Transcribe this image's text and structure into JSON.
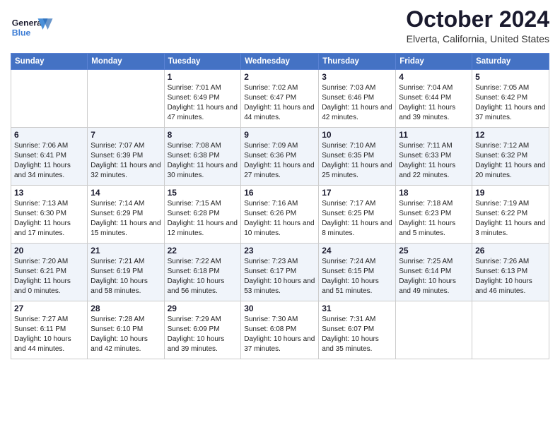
{
  "header": {
    "logo_line1": "General",
    "logo_line2": "Blue",
    "month_title": "October 2024",
    "location": "Elverta, California, United States"
  },
  "days_of_week": [
    "Sunday",
    "Monday",
    "Tuesday",
    "Wednesday",
    "Thursday",
    "Friday",
    "Saturday"
  ],
  "weeks": [
    [
      {
        "day": "",
        "sunrise": "",
        "sunset": "",
        "daylight": ""
      },
      {
        "day": "",
        "sunrise": "",
        "sunset": "",
        "daylight": ""
      },
      {
        "day": "1",
        "sunrise": "Sunrise: 7:01 AM",
        "sunset": "Sunset: 6:49 PM",
        "daylight": "Daylight: 11 hours and 47 minutes."
      },
      {
        "day": "2",
        "sunrise": "Sunrise: 7:02 AM",
        "sunset": "Sunset: 6:47 PM",
        "daylight": "Daylight: 11 hours and 44 minutes."
      },
      {
        "day": "3",
        "sunrise": "Sunrise: 7:03 AM",
        "sunset": "Sunset: 6:46 PM",
        "daylight": "Daylight: 11 hours and 42 minutes."
      },
      {
        "day": "4",
        "sunrise": "Sunrise: 7:04 AM",
        "sunset": "Sunset: 6:44 PM",
        "daylight": "Daylight: 11 hours and 39 minutes."
      },
      {
        "day": "5",
        "sunrise": "Sunrise: 7:05 AM",
        "sunset": "Sunset: 6:42 PM",
        "daylight": "Daylight: 11 hours and 37 minutes."
      }
    ],
    [
      {
        "day": "6",
        "sunrise": "Sunrise: 7:06 AM",
        "sunset": "Sunset: 6:41 PM",
        "daylight": "Daylight: 11 hours and 34 minutes."
      },
      {
        "day": "7",
        "sunrise": "Sunrise: 7:07 AM",
        "sunset": "Sunset: 6:39 PM",
        "daylight": "Daylight: 11 hours and 32 minutes."
      },
      {
        "day": "8",
        "sunrise": "Sunrise: 7:08 AM",
        "sunset": "Sunset: 6:38 PM",
        "daylight": "Daylight: 11 hours and 30 minutes."
      },
      {
        "day": "9",
        "sunrise": "Sunrise: 7:09 AM",
        "sunset": "Sunset: 6:36 PM",
        "daylight": "Daylight: 11 hours and 27 minutes."
      },
      {
        "day": "10",
        "sunrise": "Sunrise: 7:10 AM",
        "sunset": "Sunset: 6:35 PM",
        "daylight": "Daylight: 11 hours and 25 minutes."
      },
      {
        "day": "11",
        "sunrise": "Sunrise: 7:11 AM",
        "sunset": "Sunset: 6:33 PM",
        "daylight": "Daylight: 11 hours and 22 minutes."
      },
      {
        "day": "12",
        "sunrise": "Sunrise: 7:12 AM",
        "sunset": "Sunset: 6:32 PM",
        "daylight": "Daylight: 11 hours and 20 minutes."
      }
    ],
    [
      {
        "day": "13",
        "sunrise": "Sunrise: 7:13 AM",
        "sunset": "Sunset: 6:30 PM",
        "daylight": "Daylight: 11 hours and 17 minutes."
      },
      {
        "day": "14",
        "sunrise": "Sunrise: 7:14 AM",
        "sunset": "Sunset: 6:29 PM",
        "daylight": "Daylight: 11 hours and 15 minutes."
      },
      {
        "day": "15",
        "sunrise": "Sunrise: 7:15 AM",
        "sunset": "Sunset: 6:28 PM",
        "daylight": "Daylight: 11 hours and 12 minutes."
      },
      {
        "day": "16",
        "sunrise": "Sunrise: 7:16 AM",
        "sunset": "Sunset: 6:26 PM",
        "daylight": "Daylight: 11 hours and 10 minutes."
      },
      {
        "day": "17",
        "sunrise": "Sunrise: 7:17 AM",
        "sunset": "Sunset: 6:25 PM",
        "daylight": "Daylight: 11 hours and 8 minutes."
      },
      {
        "day": "18",
        "sunrise": "Sunrise: 7:18 AM",
        "sunset": "Sunset: 6:23 PM",
        "daylight": "Daylight: 11 hours and 5 minutes."
      },
      {
        "day": "19",
        "sunrise": "Sunrise: 7:19 AM",
        "sunset": "Sunset: 6:22 PM",
        "daylight": "Daylight: 11 hours and 3 minutes."
      }
    ],
    [
      {
        "day": "20",
        "sunrise": "Sunrise: 7:20 AM",
        "sunset": "Sunset: 6:21 PM",
        "daylight": "Daylight: 11 hours and 0 minutes."
      },
      {
        "day": "21",
        "sunrise": "Sunrise: 7:21 AM",
        "sunset": "Sunset: 6:19 PM",
        "daylight": "Daylight: 10 hours and 58 minutes."
      },
      {
        "day": "22",
        "sunrise": "Sunrise: 7:22 AM",
        "sunset": "Sunset: 6:18 PM",
        "daylight": "Daylight: 10 hours and 56 minutes."
      },
      {
        "day": "23",
        "sunrise": "Sunrise: 7:23 AM",
        "sunset": "Sunset: 6:17 PM",
        "daylight": "Daylight: 10 hours and 53 minutes."
      },
      {
        "day": "24",
        "sunrise": "Sunrise: 7:24 AM",
        "sunset": "Sunset: 6:15 PM",
        "daylight": "Daylight: 10 hours and 51 minutes."
      },
      {
        "day": "25",
        "sunrise": "Sunrise: 7:25 AM",
        "sunset": "Sunset: 6:14 PM",
        "daylight": "Daylight: 10 hours and 49 minutes."
      },
      {
        "day": "26",
        "sunrise": "Sunrise: 7:26 AM",
        "sunset": "Sunset: 6:13 PM",
        "daylight": "Daylight: 10 hours and 46 minutes."
      }
    ],
    [
      {
        "day": "27",
        "sunrise": "Sunrise: 7:27 AM",
        "sunset": "Sunset: 6:11 PM",
        "daylight": "Daylight: 10 hours and 44 minutes."
      },
      {
        "day": "28",
        "sunrise": "Sunrise: 7:28 AM",
        "sunset": "Sunset: 6:10 PM",
        "daylight": "Daylight: 10 hours and 42 minutes."
      },
      {
        "day": "29",
        "sunrise": "Sunrise: 7:29 AM",
        "sunset": "Sunset: 6:09 PM",
        "daylight": "Daylight: 10 hours and 39 minutes."
      },
      {
        "day": "30",
        "sunrise": "Sunrise: 7:30 AM",
        "sunset": "Sunset: 6:08 PM",
        "daylight": "Daylight: 10 hours and 37 minutes."
      },
      {
        "day": "31",
        "sunrise": "Sunrise: 7:31 AM",
        "sunset": "Sunset: 6:07 PM",
        "daylight": "Daylight: 10 hours and 35 minutes."
      },
      {
        "day": "",
        "sunrise": "",
        "sunset": "",
        "daylight": ""
      },
      {
        "day": "",
        "sunrise": "",
        "sunset": "",
        "daylight": ""
      }
    ]
  ]
}
